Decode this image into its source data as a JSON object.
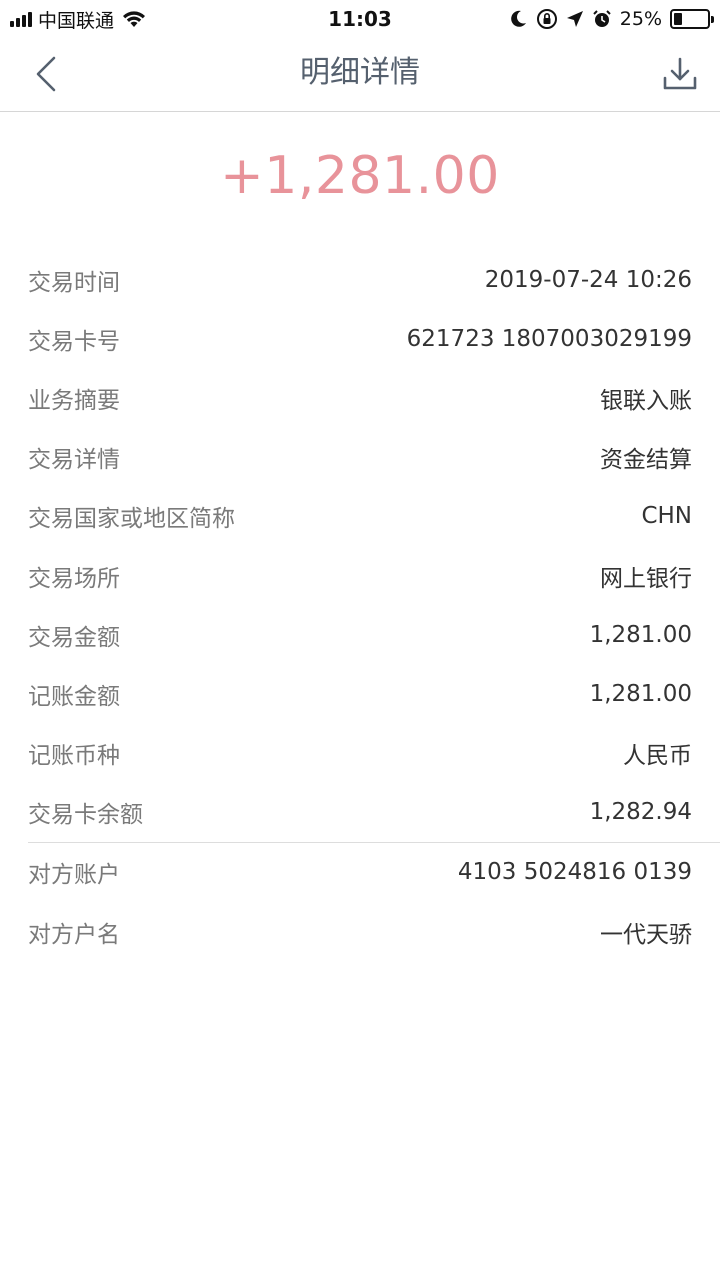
{
  "status_bar": {
    "carrier": "中国联通",
    "time": "11:03",
    "battery_percent": "25%",
    "battery_level": 0.25
  },
  "nav": {
    "title": "明细详情",
    "back_icon": "chevron-left-icon",
    "download_icon": "download-icon"
  },
  "amount": "+1,281.00",
  "colors": {
    "amount": "#e8939a",
    "title": "#55606e",
    "label": "#7a7a7a",
    "value": "#333333"
  },
  "details": [
    {
      "label": "交易时间",
      "value": "2019-07-24 10:26"
    },
    {
      "label": "交易卡号",
      "value": "621723 1807003029199"
    },
    {
      "label": "业务摘要",
      "value": "银联入账"
    },
    {
      "label": "交易详情",
      "value": "资金结算"
    },
    {
      "label": "交易国家或地区简称",
      "value": "CHN"
    },
    {
      "label": "交易场所",
      "value": "网上银行"
    },
    {
      "label": "交易金额",
      "value": "1,281.00"
    },
    {
      "label": "记账金额",
      "value": "1,281.00"
    },
    {
      "label": "记账币种",
      "value": "人民币"
    },
    {
      "label": "交易卡余额",
      "value": "1,282.94"
    }
  ],
  "counterparty": [
    {
      "label": "对方账户",
      "value": "4103 5024816 0139"
    },
    {
      "label": "对方户名",
      "value": "一代天骄"
    }
  ]
}
